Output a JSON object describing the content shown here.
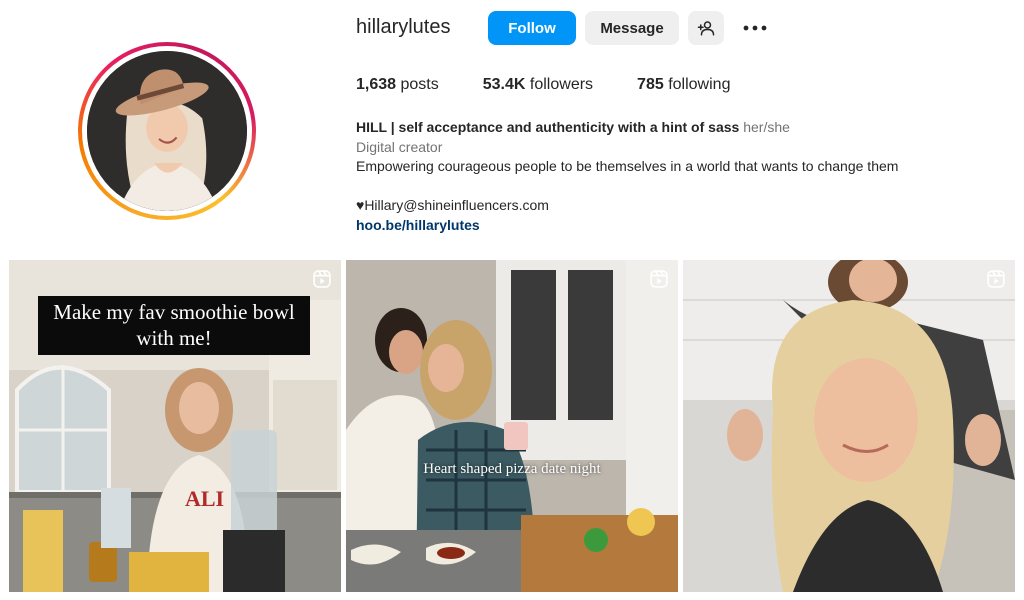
{
  "profile": {
    "username": "hillarylutes",
    "follow_label": "Follow",
    "message_label": "Message"
  },
  "stats": {
    "posts_count": "1,638",
    "posts_label": "posts",
    "followers_count": "53.4K",
    "followers_label": "followers",
    "following_count": "785",
    "following_label": "following"
  },
  "bio": {
    "name": "HILL | self acceptance and authenticity with a hint of sass",
    "pronouns": "her/she",
    "category": "Digital creator",
    "line1": "Empowering courageous people to be themselves in a world that wants to change them",
    "contact": "♥Hillary@shineinfluencers.com",
    "link": "hoo.be/hillarylutes"
  },
  "posts": [
    {
      "caption": "Make my fav smoothie bowl with me!",
      "type": "reel"
    },
    {
      "caption": "Heart shaped pizza date night",
      "type": "reel"
    },
    {
      "caption": "",
      "type": "reel"
    }
  ],
  "colors": {
    "follow_button": "#0095f6",
    "secondary_button": "#efefef",
    "link": "#00376b",
    "muted_text": "#737373"
  },
  "icons": [
    "add-user-icon",
    "more-options-icon",
    "reel-icon"
  ]
}
